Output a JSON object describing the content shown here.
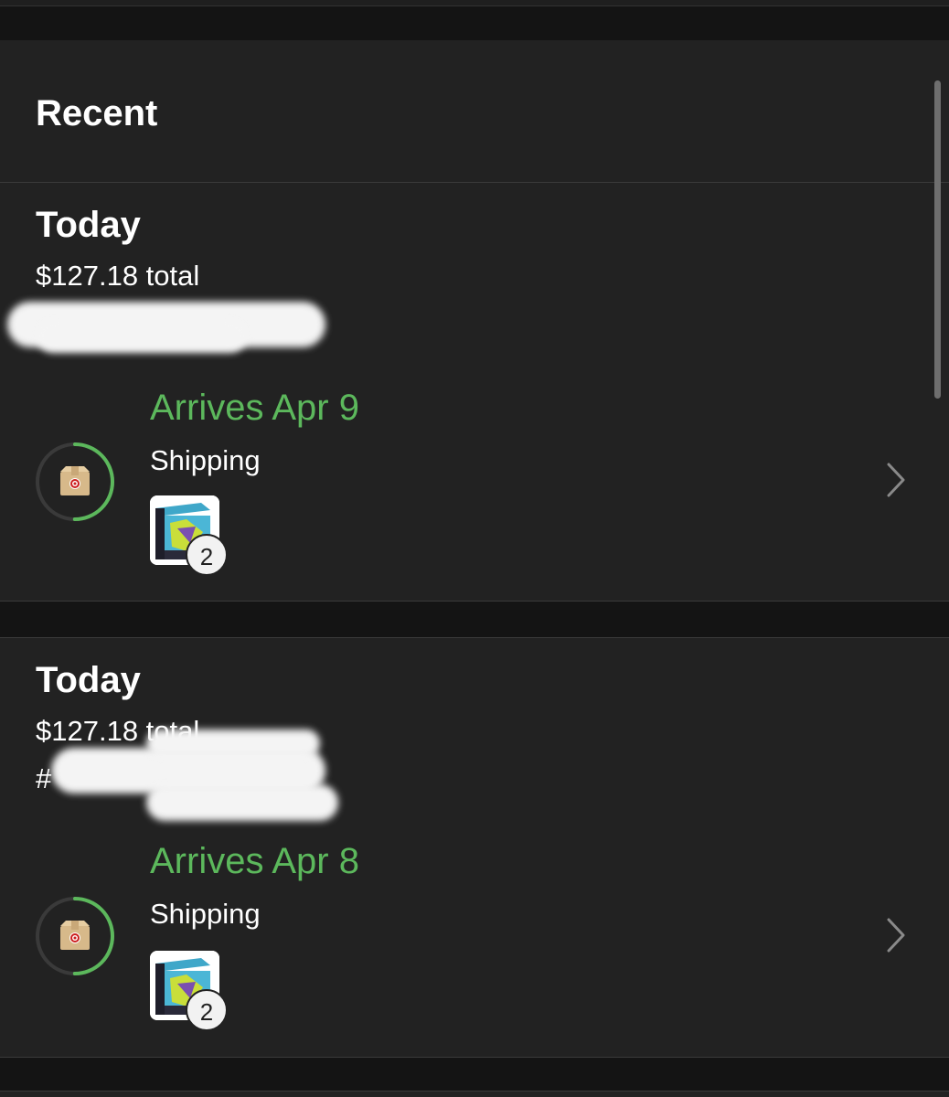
{
  "header": {
    "title": "Recent"
  },
  "orders": [
    {
      "date": "Today",
      "total": "$127.18 total",
      "arrives": "Arrives Apr 9",
      "status": "Shipping",
      "item_count": "2",
      "progress": 0.5
    },
    {
      "date": "Today",
      "total": "$127.18 total",
      "order_number_prefix": "#",
      "arrives": "Arrives Apr 8",
      "status": "Shipping",
      "item_count": "2",
      "progress": 0.5
    }
  ],
  "colors": {
    "background": "#141414",
    "panel": "#222222",
    "accent_green": "#5cb85c",
    "text": "#ffffff"
  },
  "icons": {
    "order_icon": "package-box-icon",
    "row_action": "chevron-right-icon"
  }
}
